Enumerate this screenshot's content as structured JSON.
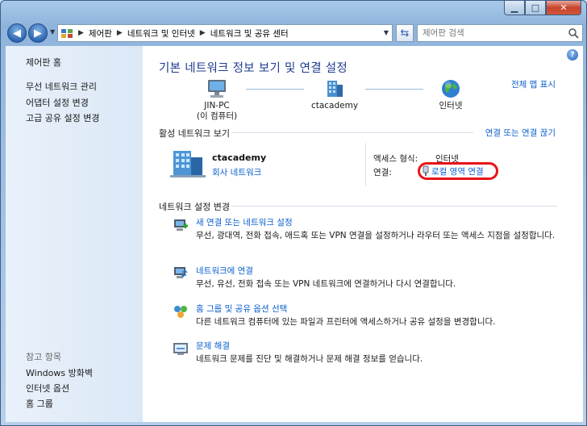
{
  "address": {
    "crumbs": [
      "제어판",
      "네트워크 및 인터넷",
      "네트워크 및 공유 센터"
    ]
  },
  "search": {
    "placeholder": "제어판 검색"
  },
  "sidebar": {
    "items": [
      "제어판 홈",
      "무선 네트워크 관리",
      "어댑터 설정 변경",
      "고급 공유 설정 변경"
    ],
    "see_also_title": "참고 항목",
    "see_also": [
      "Windows 방화벽",
      "인터넷 옵션",
      "홈 그룹"
    ]
  },
  "main": {
    "title": "기본 네트워크 정보 보기 및 연결 설정",
    "full_map": "전체 맵 표시",
    "map": {
      "computer_name": "JIN-PC",
      "computer_sub": "(이 컴퓨터)",
      "network_name": "ctacademy",
      "internet": "인터넷"
    },
    "active": {
      "header": "활성 네트워크 보기",
      "connect_link": "연결 또는 연결 끊기",
      "name": "ctacademy",
      "type": "회사 네트워크",
      "access_label": "액세스 형식:",
      "access_value": "인터넷",
      "conn_label": "연결:",
      "conn_value": "로컬 영역 연결"
    },
    "settings": {
      "header": "네트워크 설정 변경",
      "tasks": [
        {
          "title": "새 연결 또는 네트워크 설정",
          "desc": "무선, 광대역, 전화 접속, 애드혹 또는 VPN 연결을 설정하거나 라우터 또는 액세스 지점을 설정합니다."
        },
        {
          "title": "네트워크에 연결",
          "desc": "무선, 유선, 전화 접속 또는 VPN 네트워크에 연결하거나 다시 연결합니다."
        },
        {
          "title": "홈 그룹 및 공유 옵션 선택",
          "desc": "다른 네트워크 컴퓨터에 있는 파일과 프린터에 액세스하거나 공유 설정을 변경합니다."
        },
        {
          "title": "문제 해결",
          "desc": "네트워크 문제를 진단 및 해결하거나 문제 해결 정보를 얻습니다."
        }
      ]
    }
  }
}
